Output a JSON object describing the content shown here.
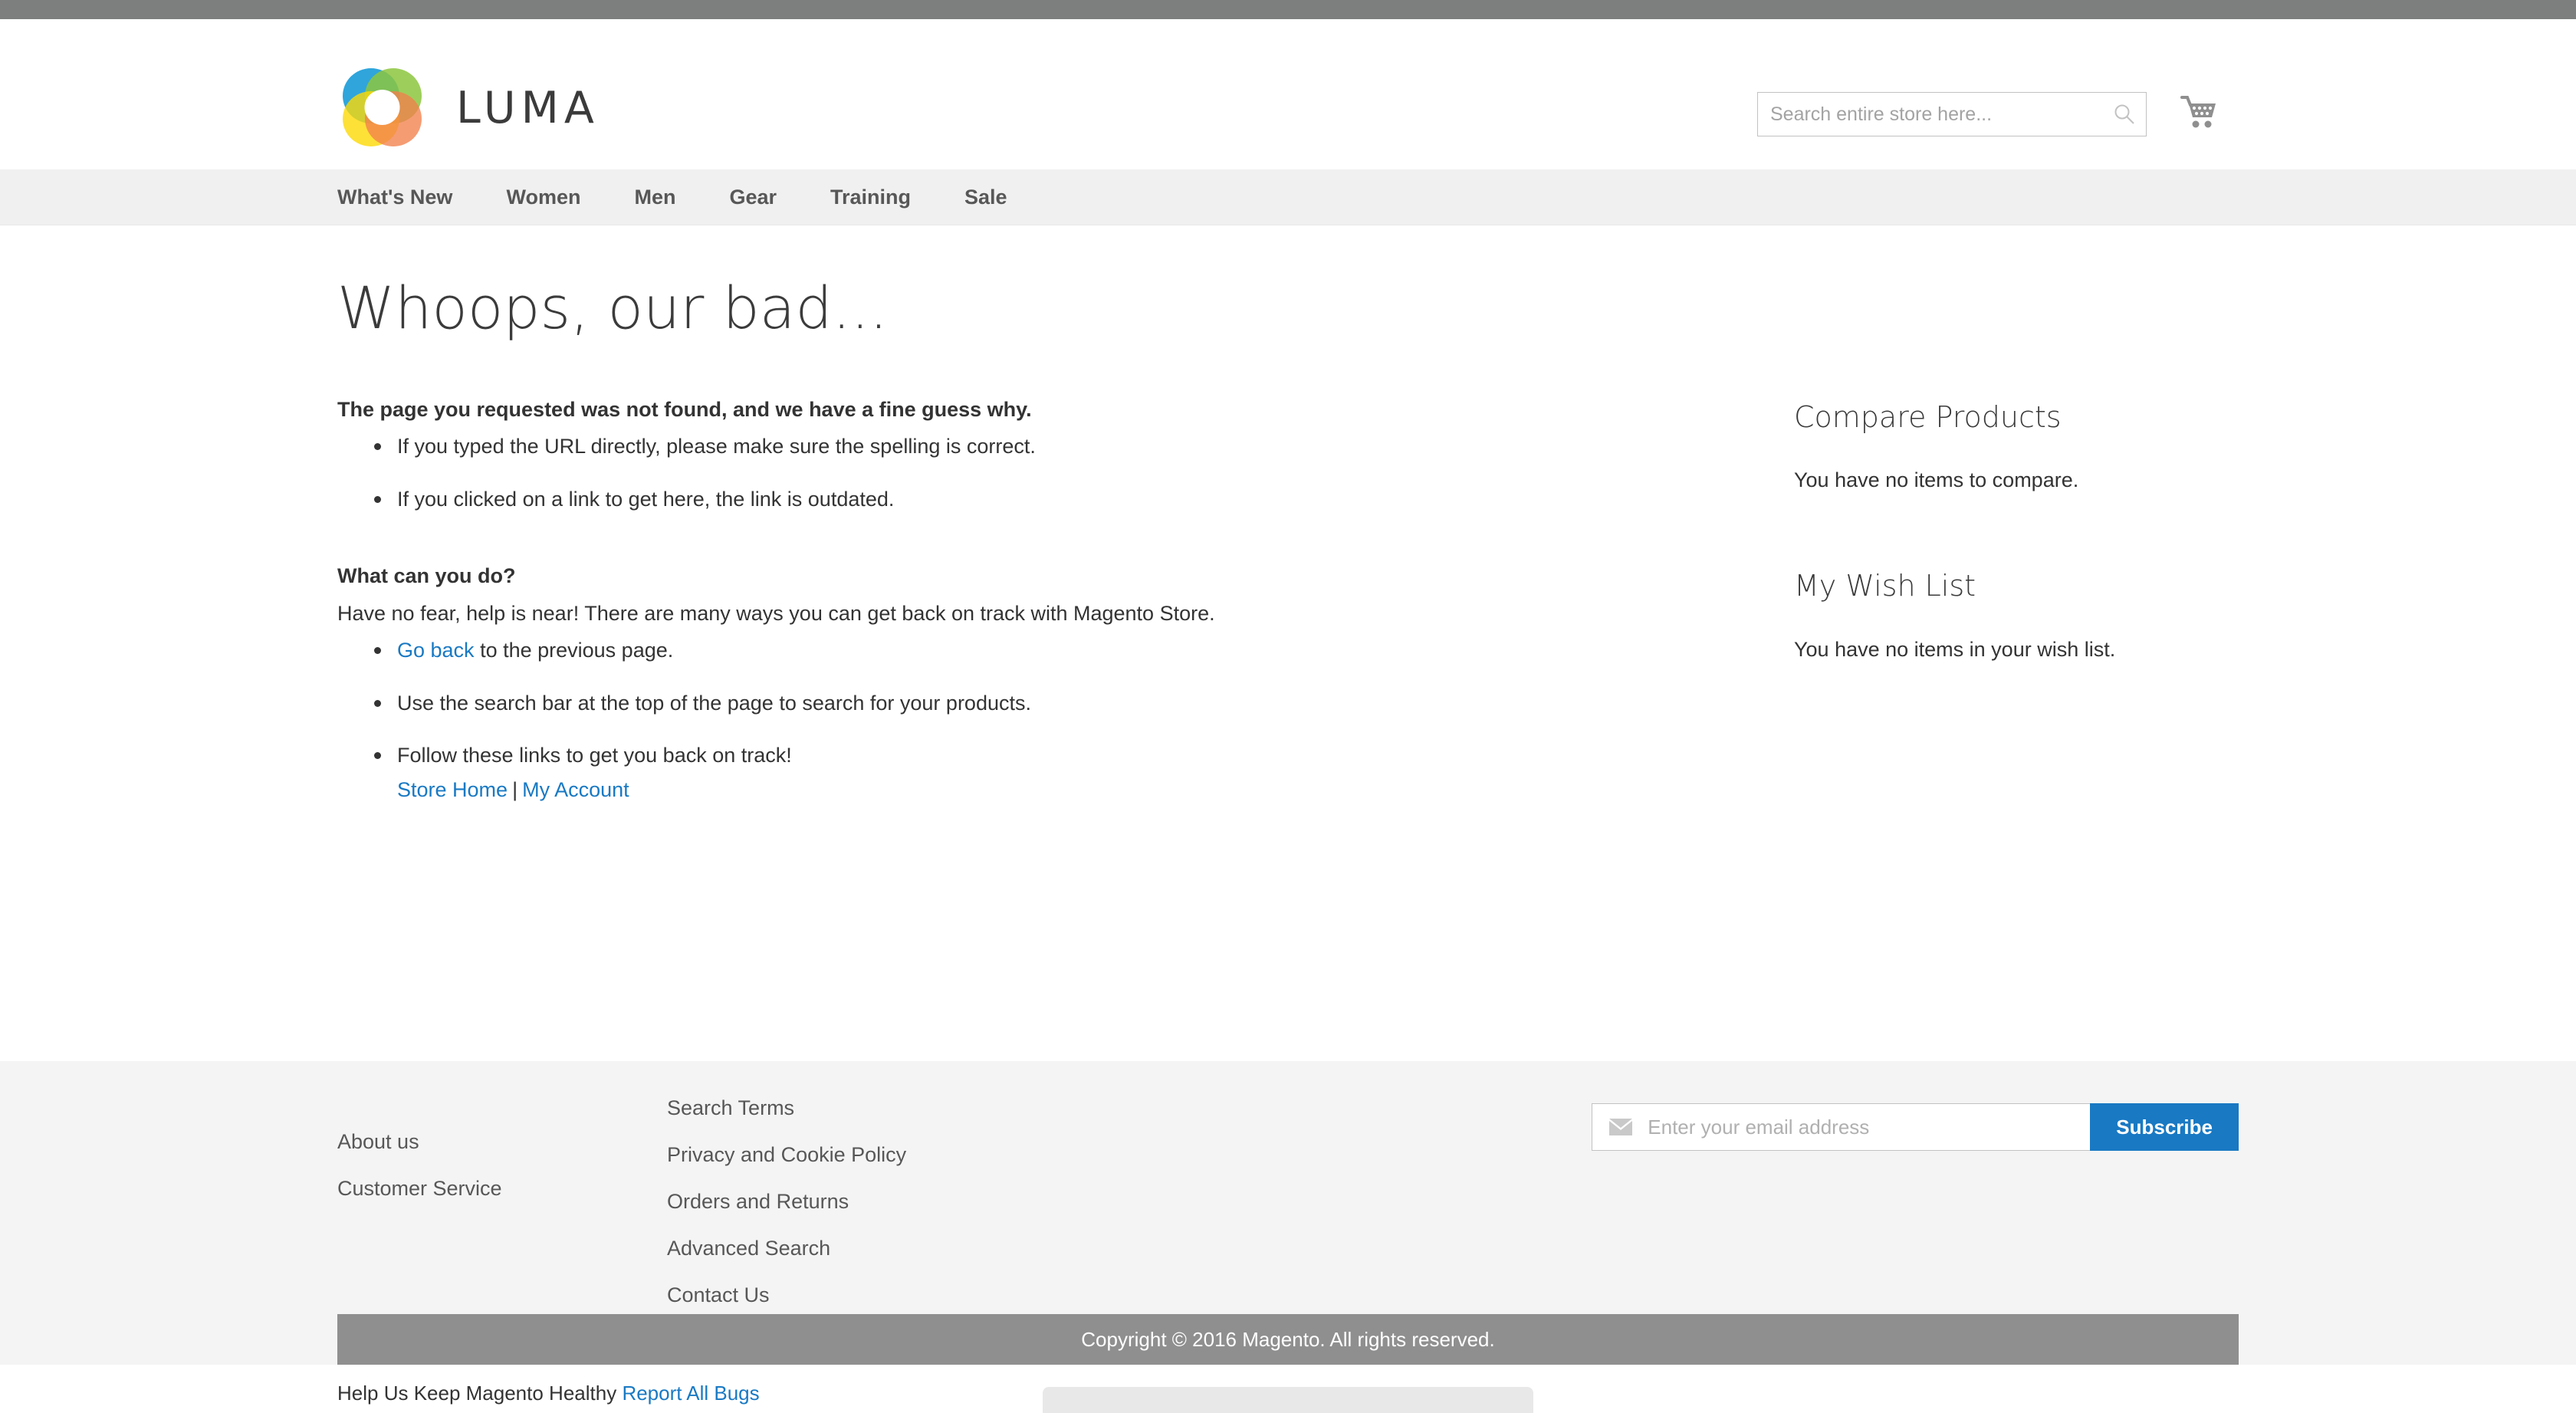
{
  "brand": {
    "name": "LUMA",
    "logo_colors": {
      "blue": "#2fa5dc",
      "green": "#8cc63e",
      "yellow": "#fcd905",
      "orange": "#f2804b"
    }
  },
  "header": {
    "search": {
      "placeholder": "Search entire store here...",
      "value": "",
      "icon": "search-icon"
    },
    "cart": {
      "icon": "shopping-cart-icon",
      "count": ""
    }
  },
  "nav": {
    "items": [
      {
        "label": "What's New"
      },
      {
        "label": "Women"
      },
      {
        "label": "Men"
      },
      {
        "label": "Gear"
      },
      {
        "label": "Training"
      },
      {
        "label": "Sale"
      }
    ]
  },
  "main": {
    "title": "Whoops, our bad...",
    "lead": "The page you requested was not found, and we have a fine guess why.",
    "reasons": [
      "If you typed the URL directly, please make sure the spelling is correct.",
      "If you clicked on a link to get here, the link is outdated."
    ],
    "what_can_you_do_heading": "What can you do?",
    "what_can_you_do_text": "Have no fear, help is near! There are many ways you can get back on track with Magento Store.",
    "action_go_back_link": "Go back",
    "action_go_back_rest": " to the previous page.",
    "action_search": "Use the search bar at the top of the page to search for your products.",
    "action_follow": "Follow these links to get you back on track!",
    "store_home_link": "Store Home",
    "link_separator": "|",
    "my_account_link": "My Account"
  },
  "sidebar": {
    "compare": {
      "title": "Compare Products",
      "empty_text": "You have no items to compare."
    },
    "wishlist": {
      "title": "My Wish List",
      "empty_text": "You have no items in your wish list."
    }
  },
  "footer": {
    "col_a": [
      {
        "label": "About us"
      },
      {
        "label": "Customer Service"
      }
    ],
    "col_b": [
      {
        "label": "Search Terms"
      },
      {
        "label": "Privacy and Cookie Policy"
      },
      {
        "label": "Orders and Returns"
      },
      {
        "label": "Advanced Search"
      },
      {
        "label": "Contact Us"
      }
    ],
    "newsletter": {
      "placeholder": "Enter your email address",
      "value": "",
      "button_label": "Subscribe",
      "icon": "envelope-icon",
      "button_color": "#1979c3"
    },
    "copyright": "Copyright © 2016 Magento. All rights reserved.",
    "bugs_text": "Help Us Keep Magento Healthy",
    "bugs_link": "Report All Bugs"
  },
  "colors": {
    "link": "#1979c3",
    "top_strip": "#7d7f7e",
    "nav_bg": "#f0f0f0",
    "footer_bg": "#f4f4f4",
    "copyright_bg": "#8f8f8f"
  }
}
